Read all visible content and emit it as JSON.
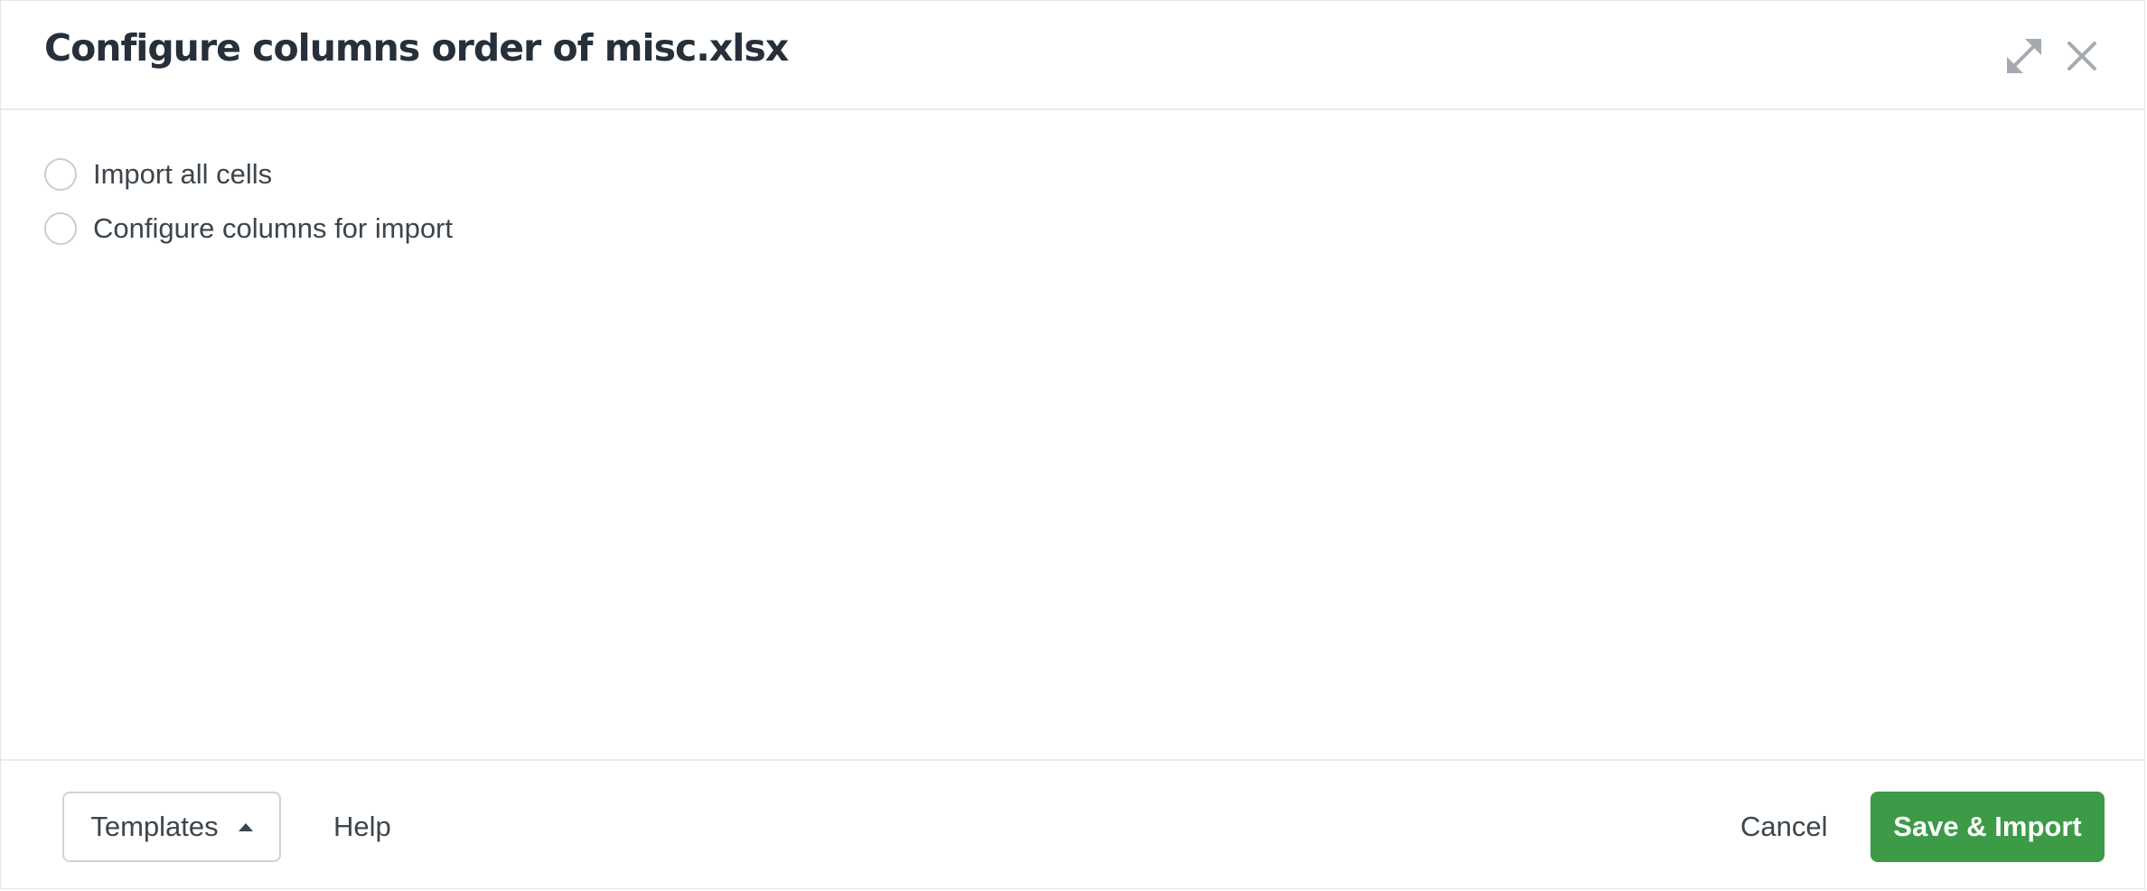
{
  "dialog": {
    "title": "Configure columns order of misc.xlsx",
    "expand_icon": "expand-icon",
    "close_icon": "close-icon"
  },
  "options": [
    {
      "label": "Import all cells",
      "selected": false
    },
    {
      "label": "Configure columns for import",
      "selected": false
    }
  ],
  "footer": {
    "templates_label": "Templates",
    "templates_icon": "caret-up-icon",
    "help_label": "Help",
    "cancel_label": "Cancel",
    "save_label": "Save & Import"
  },
  "colors": {
    "primary_button": "#3d9a47",
    "title_text": "#26303a",
    "body_text": "#3d454c",
    "border": "#e9ecee"
  }
}
